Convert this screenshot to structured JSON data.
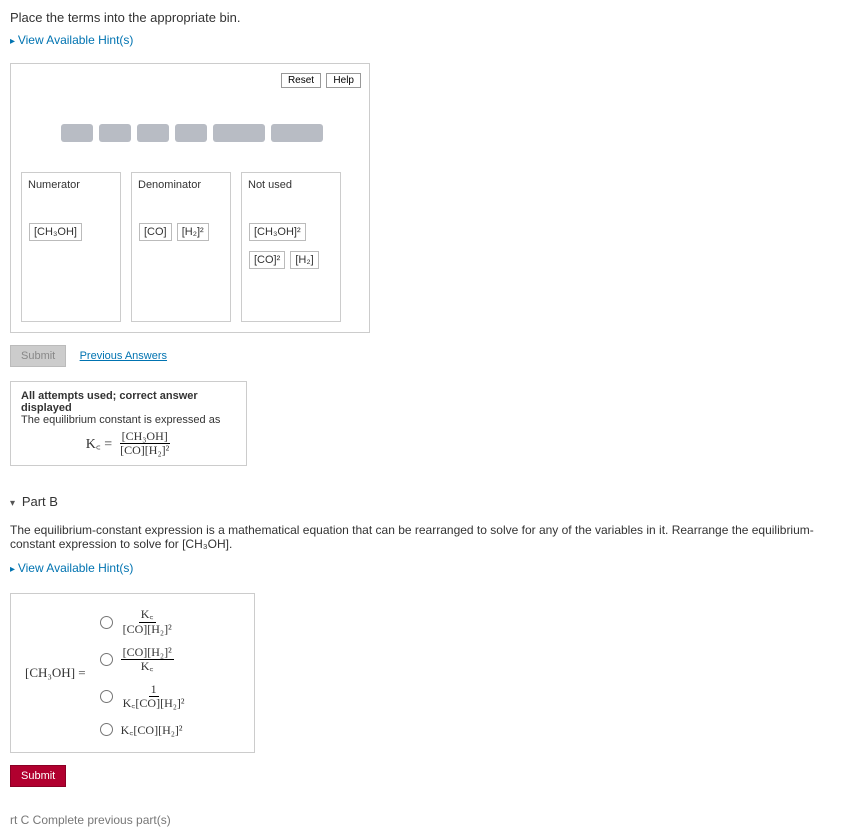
{
  "partA": {
    "instruction": "Place the terms into the appropriate bin.",
    "hints_label": "View Available Hint(s)",
    "reset_label": "Reset",
    "help_label": "Help",
    "bins": {
      "numerator": {
        "title": "Numerator",
        "items": [
          "[CH₃OH]"
        ]
      },
      "denominator": {
        "title": "Denominator",
        "items": [
          "[CO]",
          "[H₂]²"
        ]
      },
      "not_used": {
        "title": "Not used",
        "items_row1": [
          "[CH₃OH]²"
        ],
        "items_row2": [
          "[CO]²",
          "[H₂]"
        ]
      }
    },
    "submit_label": "Submit",
    "prev_answers_label": "Previous Answers",
    "feedback": {
      "line1": "All attempts used; correct answer displayed",
      "line2": "The equilibrium constant is expressed as",
      "kc_label": "K꜀ =",
      "numerator": "[CH₃OH]",
      "denominator": "[CO][H₂]²"
    }
  },
  "partB": {
    "title": "Part B",
    "text": "The equilibrium-constant expression is a mathematical equation that can be rearranged to solve for any of the variables in it. Rearrange the equilibrium-constant expression to solve for [CH₃OH].",
    "hints_label": "View Available Hint(s)",
    "lhs": "[CH₃OH] =",
    "options": {
      "opt1": {
        "num": "K꜀",
        "den": "[CO][H₂]²"
      },
      "opt2": {
        "num": "[CO][H₂]²",
        "den": "K꜀"
      },
      "opt3": {
        "num": "1",
        "den": "K꜀[CO][H₂]²"
      },
      "opt4": "K꜀[CO][H₂]²"
    },
    "submit_label": "Submit"
  },
  "partC": {
    "label": "rt C   Complete previous part(s)"
  }
}
